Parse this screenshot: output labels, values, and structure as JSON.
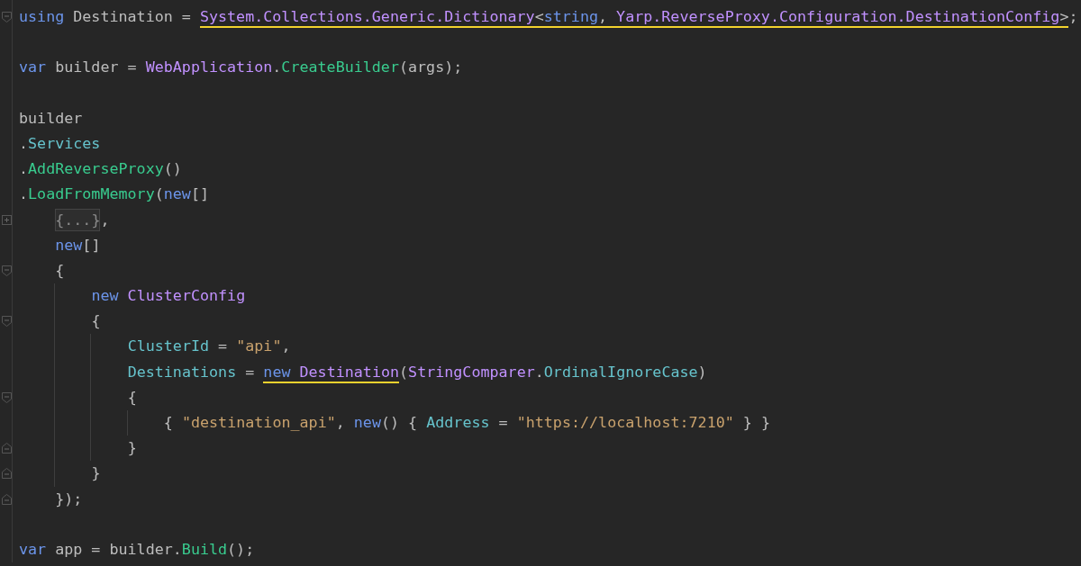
{
  "editor": {
    "lines": [
      {
        "kind": "code",
        "fold": {
          "kind": "start"
        },
        "tokens": [
          {
            "text": "using",
            "kind": "keyword",
            "underlined": false
          },
          {
            "text": " Destination = ",
            "kind": "plain",
            "underlined": false
          },
          {
            "text": "System.Collections.Generic.Dictionary",
            "kind": "type",
            "underlined": true
          },
          {
            "text": "<",
            "kind": "plain",
            "underlined": true
          },
          {
            "text": "string",
            "kind": "keyword",
            "underlined": true
          },
          {
            "text": ", ",
            "kind": "plain",
            "underlined": true
          },
          {
            "text": "Yarp.ReverseProxy.Configuration.DestinationConfig",
            "kind": "type",
            "underlined": true
          },
          {
            "text": ">",
            "kind": "plain",
            "underlined": true
          },
          {
            "text": ";",
            "kind": "plain",
            "underlined": false
          }
        ]
      },
      {
        "kind": "blank"
      },
      {
        "kind": "code",
        "tokens": [
          {
            "text": "var",
            "kind": "keyword",
            "underlined": false
          },
          {
            "text": " builder = ",
            "kind": "plain",
            "underlined": false
          },
          {
            "text": "WebApplication",
            "kind": "type",
            "underlined": false
          },
          {
            "text": ".",
            "kind": "plain",
            "underlined": false
          },
          {
            "text": "CreateBuilder",
            "kind": "method",
            "underlined": false
          },
          {
            "text": "(args);",
            "kind": "plain",
            "underlined": false
          }
        ]
      },
      {
        "kind": "blank"
      },
      {
        "kind": "code",
        "tokens": [
          {
            "text": "builder",
            "kind": "plain",
            "underlined": false
          }
        ]
      },
      {
        "kind": "code",
        "tokens": [
          {
            "text": ".",
            "kind": "plain",
            "underlined": false
          },
          {
            "text": "Services",
            "kind": "property",
            "underlined": false
          }
        ]
      },
      {
        "kind": "code",
        "tokens": [
          {
            "text": ".",
            "kind": "plain",
            "underlined": false
          },
          {
            "text": "AddReverseProxy",
            "kind": "method",
            "underlined": false
          },
          {
            "text": "()",
            "kind": "plain",
            "underlined": false
          }
        ]
      },
      {
        "kind": "code",
        "tokens": [
          {
            "text": ".",
            "kind": "plain",
            "underlined": false
          },
          {
            "text": "LoadFromMemory",
            "kind": "method",
            "underlined": false
          },
          {
            "text": "(",
            "kind": "plain",
            "underlined": false
          },
          {
            "text": "new",
            "kind": "keyword",
            "underlined": false
          },
          {
            "text": "[]",
            "kind": "plain",
            "underlined": false
          }
        ],
        "children": [
          {
            "kind": "code",
            "fold": {
              "kind": "collapsed"
            },
            "tokens": [
              {
                "text": "{...}",
                "kind": "folded",
                "underlined": false
              },
              {
                "text": ",",
                "kind": "plain",
                "underlined": false
              }
            ]
          },
          {
            "kind": "code",
            "tokens": [
              {
                "text": "new",
                "kind": "keyword",
                "underlined": false
              },
              {
                "text": "[]",
                "kind": "plain",
                "underlined": false
              }
            ]
          },
          {
            "kind": "code",
            "fold": {
              "kind": "start"
            },
            "tokens": [
              {
                "text": "{",
                "kind": "plain",
                "underlined": false
              }
            ],
            "children": [
              {
                "kind": "code",
                "tokens": [
                  {
                    "text": "new ",
                    "kind": "keyword",
                    "underlined": false
                  },
                  {
                    "text": "ClusterConfig",
                    "kind": "type",
                    "underlined": false
                  }
                ]
              },
              {
                "kind": "code",
                "fold": {
                  "kind": "start"
                },
                "tokens": [
                  {
                    "text": "{",
                    "kind": "plain",
                    "underlined": false
                  }
                ],
                "children": [
                  {
                    "kind": "code",
                    "tokens": [
                      {
                        "text": "ClusterId",
                        "kind": "property",
                        "underlined": false
                      },
                      {
                        "text": " = ",
                        "kind": "plain",
                        "underlined": false
                      },
                      {
                        "text": "\"api\"",
                        "kind": "string",
                        "underlined": false
                      },
                      {
                        "text": ",",
                        "kind": "plain",
                        "underlined": false
                      }
                    ]
                  },
                  {
                    "kind": "code",
                    "tokens": [
                      {
                        "text": "Destinations",
                        "kind": "property",
                        "underlined": false
                      },
                      {
                        "text": " = ",
                        "kind": "plain",
                        "underlined": false
                      },
                      {
                        "text": "new ",
                        "kind": "keyword",
                        "underlined": true
                      },
                      {
                        "text": "Destination",
                        "kind": "type",
                        "underlined": true
                      },
                      {
                        "text": "(",
                        "kind": "plain",
                        "underlined": false
                      },
                      {
                        "text": "StringComparer",
                        "kind": "type",
                        "underlined": false
                      },
                      {
                        "text": ".",
                        "kind": "plain",
                        "underlined": false
                      },
                      {
                        "text": "OrdinalIgnoreCase",
                        "kind": "property",
                        "underlined": false
                      },
                      {
                        "text": ")",
                        "kind": "plain",
                        "underlined": false
                      }
                    ]
                  },
                  {
                    "kind": "code",
                    "fold": {
                      "kind": "start"
                    },
                    "tokens": [
                      {
                        "text": "{",
                        "kind": "plain",
                        "underlined": false
                      }
                    ],
                    "children": [
                      {
                        "kind": "code",
                        "tokens": [
                          {
                            "text": "{ ",
                            "kind": "plain",
                            "underlined": false
                          },
                          {
                            "text": "\"destination_api\"",
                            "kind": "string",
                            "underlined": false
                          },
                          {
                            "text": ", ",
                            "kind": "plain",
                            "underlined": false
                          },
                          {
                            "text": "new",
                            "kind": "keyword",
                            "underlined": false
                          },
                          {
                            "text": "() { ",
                            "kind": "plain",
                            "underlined": false
                          },
                          {
                            "text": "Address",
                            "kind": "property",
                            "underlined": false
                          },
                          {
                            "text": " = ",
                            "kind": "plain",
                            "underlined": false
                          },
                          {
                            "text": "\"https://localhost:7210\"",
                            "kind": "string",
                            "underlined": false
                          },
                          {
                            "text": " } }",
                            "kind": "plain",
                            "underlined": false
                          }
                        ]
                      }
                    ]
                  },
                  {
                    "kind": "code",
                    "fold": {
                      "kind": "end"
                    },
                    "tokens": [
                      {
                        "text": "}",
                        "kind": "plain",
                        "underlined": false
                      }
                    ]
                  }
                ]
              },
              {
                "kind": "code",
                "fold": {
                  "kind": "end"
                },
                "tokens": [
                  {
                    "text": "}",
                    "kind": "plain",
                    "underlined": false
                  }
                ]
              }
            ]
          },
          {
            "kind": "code",
            "fold": {
              "kind": "end"
            },
            "tokens": [
              {
                "text": "});",
                "kind": "plain",
                "underlined": false
              }
            ]
          }
        ]
      },
      {
        "kind": "blank"
      },
      {
        "kind": "code",
        "tokens": [
          {
            "text": "var",
            "kind": "keyword",
            "underlined": false
          },
          {
            "text": " app = builder.",
            "kind": "plain",
            "underlined": false
          },
          {
            "text": "Build",
            "kind": "method",
            "underlined": false
          },
          {
            "text": "();",
            "kind": "plain",
            "underlined": false
          }
        ]
      }
    ]
  }
}
